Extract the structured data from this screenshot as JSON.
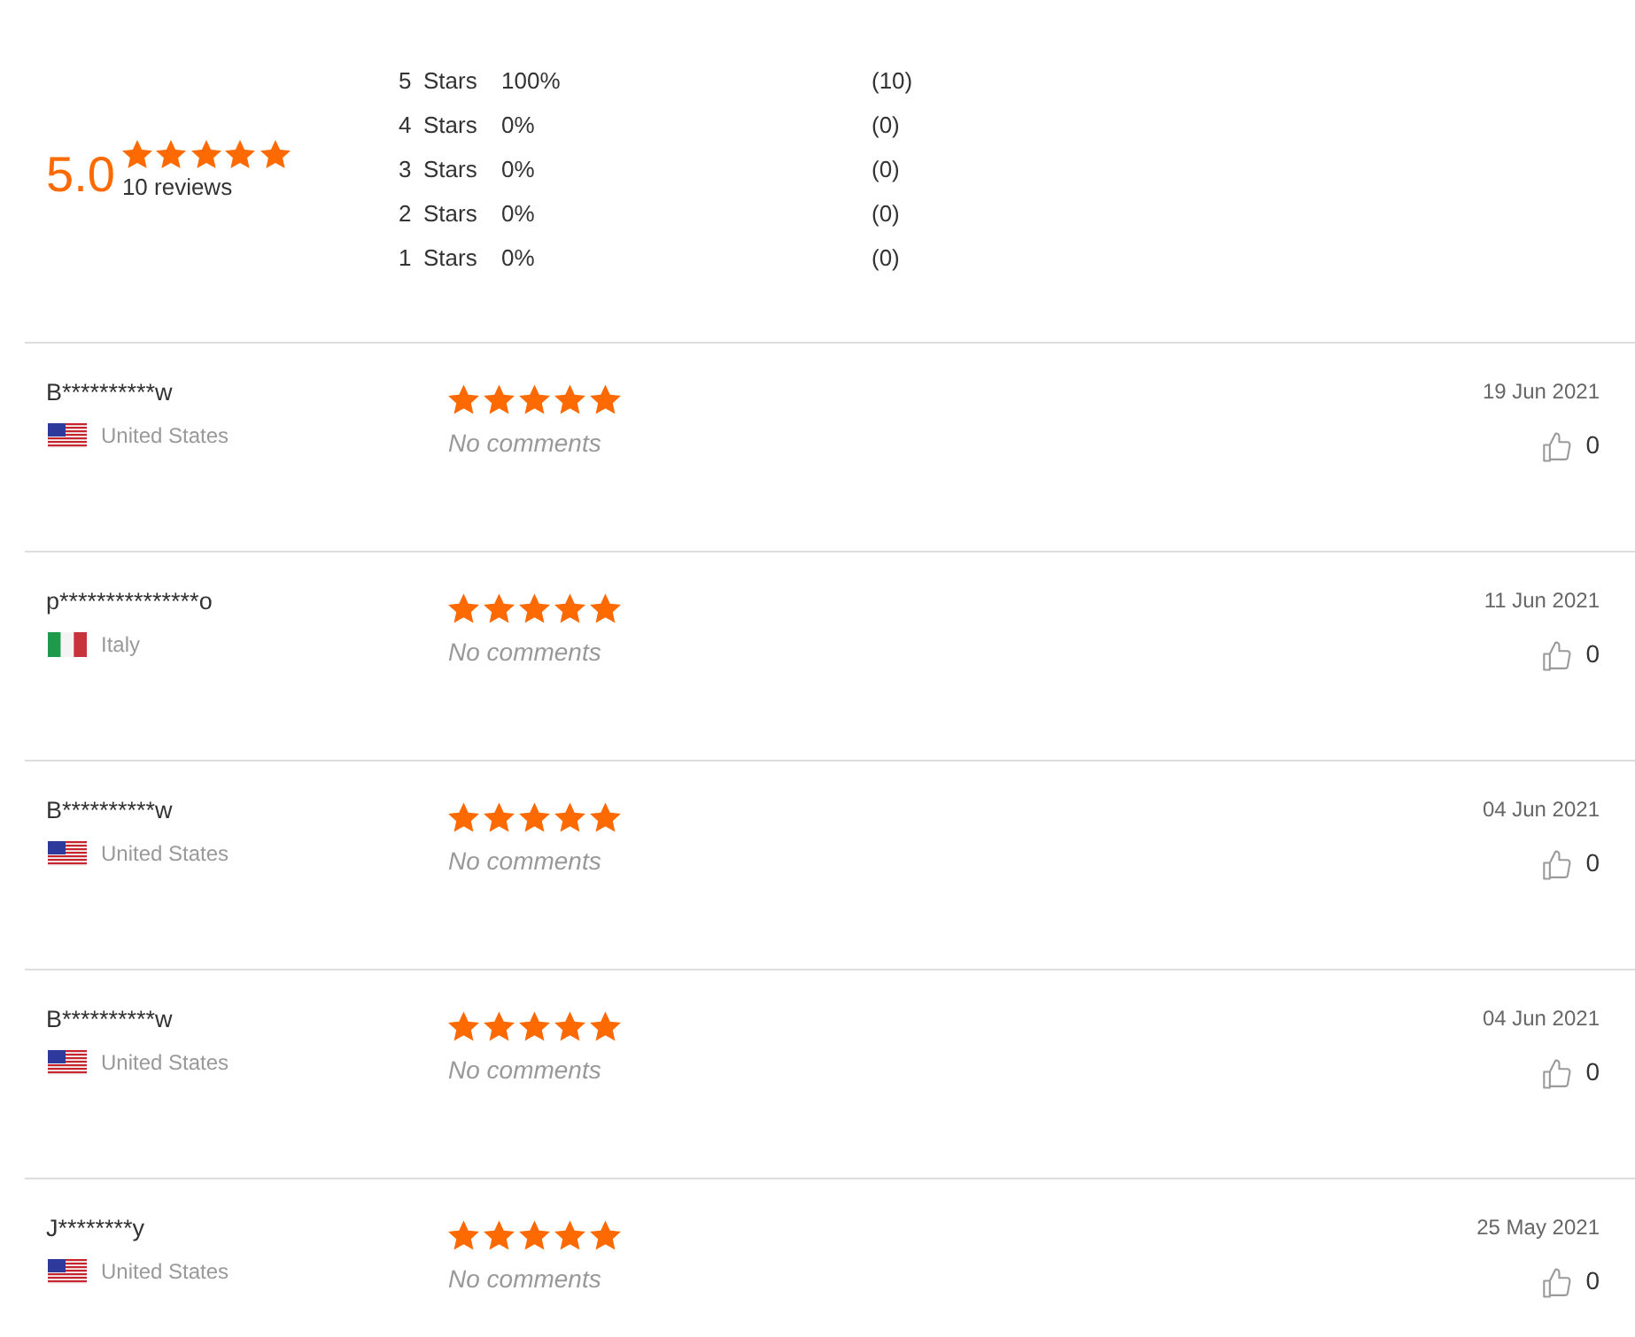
{
  "summary": {
    "score": "5.0",
    "stars": 5,
    "review_count": "10 reviews"
  },
  "distribution": [
    {
      "rating": "5",
      "label": "Stars",
      "percent": "100%",
      "count": "(10)"
    },
    {
      "rating": "4",
      "label": "Stars",
      "percent": "0%",
      "count": "(0)"
    },
    {
      "rating": "3",
      "label": "Stars",
      "percent": "0%",
      "count": "(0)"
    },
    {
      "rating": "2",
      "label": "Stars",
      "percent": "0%",
      "count": "(0)"
    },
    {
      "rating": "1",
      "label": "Stars",
      "percent": "0%",
      "count": "(0)"
    }
  ],
  "reviews": [
    {
      "name": "B**********w",
      "flag": {
        "kind": "us"
      },
      "country": "United States",
      "stars": 5,
      "comment": "No comments",
      "date": "19 Jun 2021",
      "likes": "0"
    },
    {
      "name": "p***************o",
      "flag": {
        "kind": "it"
      },
      "country": "Italy",
      "stars": 5,
      "comment": "No comments",
      "date": "11 Jun 2021",
      "likes": "0"
    },
    {
      "name": "B**********w",
      "flag": {
        "kind": "us"
      },
      "country": "United States",
      "stars": 5,
      "comment": "No comments",
      "date": "04 Jun 2021",
      "likes": "0"
    },
    {
      "name": "B**********w",
      "flag": {
        "kind": "us"
      },
      "country": "United States",
      "stars": 5,
      "comment": "No comments",
      "date": "04 Jun 2021",
      "likes": "0"
    },
    {
      "name": "J********y",
      "flag": {
        "kind": "us"
      },
      "country": "United States",
      "stars": 5,
      "comment": "No comments",
      "date": "25 May 2021",
      "likes": "0"
    }
  ]
}
